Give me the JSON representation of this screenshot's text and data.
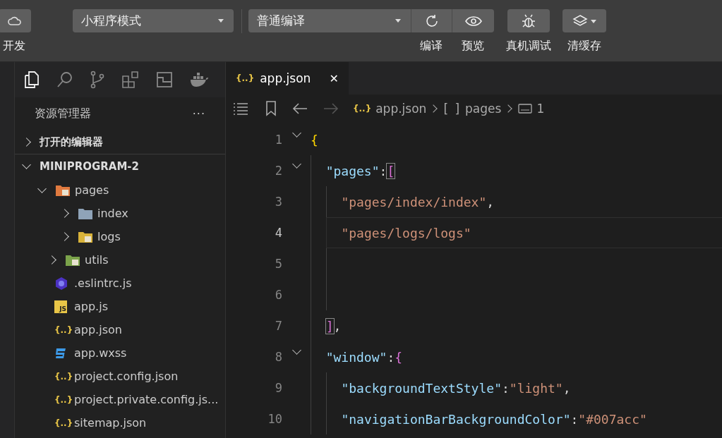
{
  "toolbar": {
    "cloud_label": "开发",
    "mode_select": "小程序模式",
    "compile_select": "普通编译",
    "actions": [
      {
        "kind": "refresh",
        "label": "编译"
      },
      {
        "kind": "eye",
        "label": "预览"
      },
      {
        "kind": "bug",
        "label": "真机调试"
      },
      {
        "kind": "layers",
        "label": "清缓存"
      }
    ]
  },
  "sidebar": {
    "title": "资源管理器",
    "more": "···",
    "sections": [
      {
        "label": "打开的编辑器",
        "expanded": false
      },
      {
        "label": "MINIPROGRAM-2",
        "expanded": true
      }
    ],
    "tree": [
      {
        "name": "pages",
        "kind": "folder-pages",
        "expanded": true,
        "children": [
          {
            "name": "index",
            "kind": "folder",
            "expanded": false
          },
          {
            "name": "logs",
            "kind": "folder-logs",
            "expanded": false
          }
        ]
      },
      {
        "name": "utils",
        "kind": "folder-utils",
        "expanded": false
      },
      {
        "name": ".eslintrc.js",
        "kind": "eslint"
      },
      {
        "name": "app.js",
        "kind": "js",
        "badge": "JS"
      },
      {
        "name": "app.json",
        "kind": "json",
        "badge": "{..}"
      },
      {
        "name": "app.wxss",
        "kind": "css"
      },
      {
        "name": "project.config.json",
        "kind": "json",
        "badge": "{..}"
      },
      {
        "name": "project.private.config.js...",
        "kind": "json",
        "badge": "{..}"
      },
      {
        "name": "sitemap.json",
        "kind": "json",
        "badge": "{..}"
      }
    ]
  },
  "editor": {
    "tabs": [
      {
        "label": "app.json",
        "badge": "{..}",
        "selected": true,
        "close": "✕"
      }
    ],
    "breadcrumb": [
      {
        "kind": "json",
        "badge": "{..}",
        "label": "app.json"
      },
      {
        "kind": "array",
        "badge": "[ ]",
        "label": "pages"
      },
      {
        "kind": "string",
        "label": "1"
      }
    ],
    "lines": [
      {
        "number": "1",
        "fold": true,
        "current": false,
        "tokens": [
          {
            "kind": "bracket",
            "text": "{"
          }
        ],
        "children": [
          {
            "number": "2",
            "fold": true,
            "current": false,
            "tokens": [
              {
                "kind": "key",
                "text": "\"pages\""
              },
              {
                "kind": "punct",
                "text": ":"
              },
              {
                "kind": "bracket2",
                "text": "[",
                "boxed": true
              }
            ],
            "children": [
              {
                "number": "3",
                "fold": false,
                "current": false,
                "tokens": [
                  {
                    "kind": "string",
                    "text": "\"pages/index/index\""
                  },
                  {
                    "kind": "punct",
                    "text": ","
                  }
                ]
              },
              {
                "number": "4",
                "fold": false,
                "current": true,
                "tokens": [
                  {
                    "kind": "string",
                    "text": "\"pages/logs/logs\""
                  }
                ]
              },
              {
                "number": "5",
                "fold": false,
                "current": false
              },
              {
                "number": "6",
                "fold": false,
                "current": false
              }
            ]
          },
          {
            "number": "7",
            "fold": false,
            "current": false,
            "tokens": [
              {
                "kind": "bracket2",
                "text": "]",
                "boxed": true
              },
              {
                "kind": "punct",
                "text": ","
              }
            ]
          },
          {
            "number": "8",
            "fold": true,
            "current": false,
            "tokens": [
              {
                "kind": "key",
                "text": "\"window\""
              },
              {
                "kind": "punct",
                "text": ":"
              },
              {
                "kind": "bracket2",
                "text": "{"
              }
            ],
            "children": [
              {
                "number": "9",
                "fold": false,
                "current": false,
                "tokens": [
                  {
                    "kind": "key",
                    "text": "\"backgroundTextStyle\""
                  },
                  {
                    "kind": "punct",
                    "text": ":"
                  },
                  {
                    "kind": "string",
                    "text": "\"light\""
                  },
                  {
                    "kind": "punct",
                    "text": ","
                  }
                ]
              },
              {
                "number": "10",
                "fold": false,
                "current": false,
                "tokens": [
                  {
                    "kind": "key",
                    "text": "\"navigationBarBackgroundColor\""
                  },
                  {
                    "kind": "punct",
                    "text": ":"
                  },
                  {
                    "kind": "string",
                    "text": "\"#007acc\""
                  }
                ]
              }
            ]
          }
        ]
      }
    ]
  }
}
